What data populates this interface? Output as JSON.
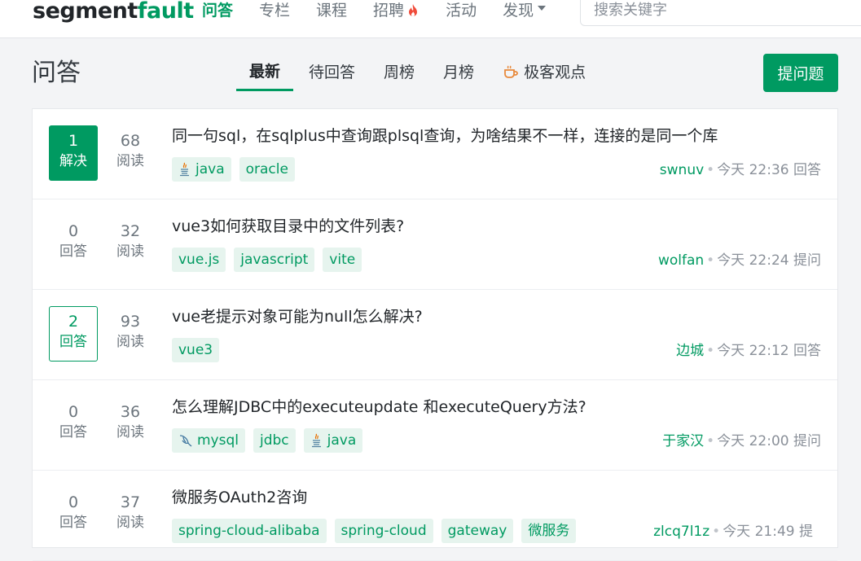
{
  "brand": {
    "part1": "segment",
    "part2": "fault"
  },
  "nav": [
    {
      "label": "问答"
    },
    {
      "label": "专栏"
    },
    {
      "label": "课程"
    },
    {
      "label": "招聘"
    },
    {
      "label": "活动"
    },
    {
      "label": "发现"
    }
  ],
  "search": {
    "placeholder": "搜索关键字"
  },
  "page": {
    "title": "问答"
  },
  "tabs": [
    {
      "label": "最新"
    },
    {
      "label": "待回答"
    },
    {
      "label": "周榜"
    },
    {
      "label": "月榜"
    },
    {
      "label": "极客观点"
    }
  ],
  "ask_button": "提问题",
  "colors": {
    "brand": "#009a61",
    "tag_bg": "#e6f4ee",
    "fire": "#f04b3a"
  },
  "questions": [
    {
      "answers": "1",
      "answer_label": "解决",
      "views": "68",
      "view_label": "阅读",
      "title": "同一句sql，在sqlplus中查询跟plsql查询，为啥结果不一样，连接的是同一个库",
      "tags": [
        "java",
        "oracle"
      ],
      "user": "swnuv",
      "time": "今天 22:36",
      "action": "回答"
    },
    {
      "answers": "0",
      "answer_label": "回答",
      "views": "32",
      "view_label": "阅读",
      "title": "vue3如何获取目录中的文件列表?",
      "tags": [
        "vue.js",
        "javascript",
        "vite"
      ],
      "user": "wolfan",
      "time": "今天 22:24",
      "action": "提问"
    },
    {
      "answers": "2",
      "answer_label": "回答",
      "views": "93",
      "view_label": "阅读",
      "title": "vue老提示对象可能为null怎么解决?",
      "tags": [
        "vue3"
      ],
      "user": "边城",
      "time": "今天 22:12",
      "action": "回答"
    },
    {
      "answers": "0",
      "answer_label": "回答",
      "views": "36",
      "view_label": "阅读",
      "title": "怎么理解JDBC中的executeupdate 和executeQuery方法?",
      "tags": [
        "mysql",
        "jdbc",
        "java"
      ],
      "user": "于家汉",
      "time": "今天 22:00",
      "action": "提问"
    },
    {
      "answers": "0",
      "answer_label": "回答",
      "views": "37",
      "view_label": "阅读",
      "title": "微服务OAuth2咨询",
      "tags": [
        "spring-cloud-alibaba",
        "spring-cloud",
        "gateway",
        "微服务"
      ],
      "user": "zlcq7l1z",
      "time": "今天 21:49",
      "action": "提"
    }
  ]
}
